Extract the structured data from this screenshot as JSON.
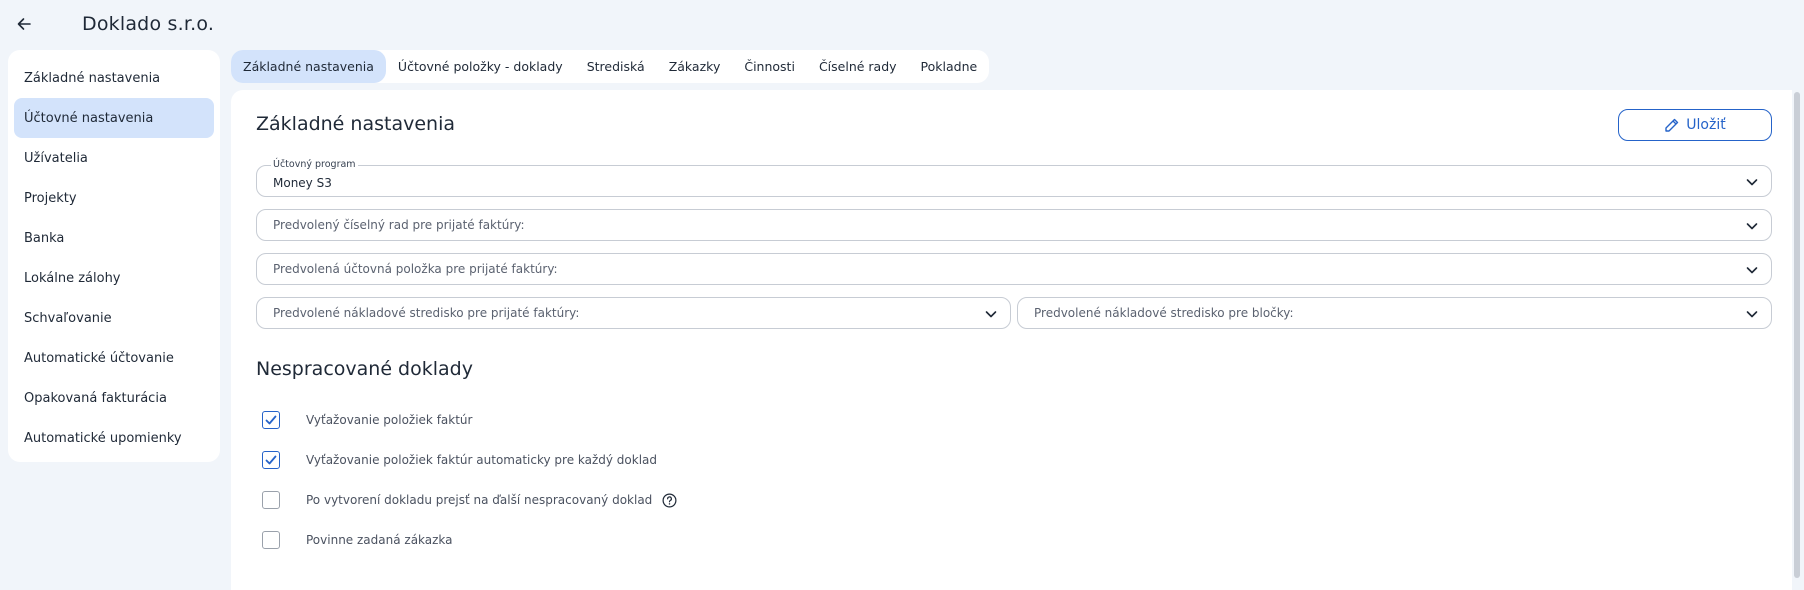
{
  "header": {
    "title": "Doklado s.r.o."
  },
  "sidebar": {
    "items": [
      {
        "label": "Základné nastavenia",
        "active": false
      },
      {
        "label": "Účtovné nastavenia",
        "active": true
      },
      {
        "label": "Užívatelia",
        "active": false
      },
      {
        "label": "Projekty",
        "active": false
      },
      {
        "label": "Banka",
        "active": false
      },
      {
        "label": "Lokálne zálohy",
        "active": false
      },
      {
        "label": "Schvaľovanie",
        "active": false
      },
      {
        "label": "Automatické účtovanie",
        "active": false
      },
      {
        "label": "Opakovaná fakturácia",
        "active": false
      },
      {
        "label": "Automatické upomienky",
        "active": false
      }
    ]
  },
  "tabs": [
    {
      "label": "Základné nastavenia",
      "active": true
    },
    {
      "label": "Účtovné položky - doklady",
      "active": false
    },
    {
      "label": "Strediská",
      "active": false
    },
    {
      "label": "Zákazky",
      "active": false
    },
    {
      "label": "Činnosti",
      "active": false
    },
    {
      "label": "Číselné rady",
      "active": false
    },
    {
      "label": "Pokladne",
      "active": false
    }
  ],
  "main": {
    "title": "Základné nastavenia",
    "save_label": "Uložiť",
    "fields": {
      "program": {
        "label": "Účtovný program",
        "value": "Money S3"
      },
      "number_series": {
        "placeholder": "Predvolený číselný rad pre prijaté faktúry:"
      },
      "accounting_item": {
        "placeholder": "Predvolená účtovná položka pre prijaté faktúry:"
      },
      "cost_center_invoices": {
        "placeholder": "Predvolené nákladové stredisko pre prijaté faktúry:"
      },
      "cost_center_receipts": {
        "placeholder": "Predvolené nákladové stredisko pre bločky:"
      }
    },
    "unprocessed": {
      "title": "Nespracované doklady",
      "checkboxes": [
        {
          "label": "Vyťažovanie položiek faktúr",
          "checked": true
        },
        {
          "label": "Vyťažovanie položiek faktúr automaticky pre každý doklad",
          "checked": true
        },
        {
          "label": "Po vytvorení dokladu prejsť na ďalší nespracovaný doklad",
          "checked": false
        },
        {
          "label": "Povinne zadaná zákazka",
          "checked": false
        }
      ]
    }
  },
  "colors": {
    "accent": "#2563c9",
    "active_bg": "#d3e3fb",
    "page_bg": "#f1f5fa"
  }
}
